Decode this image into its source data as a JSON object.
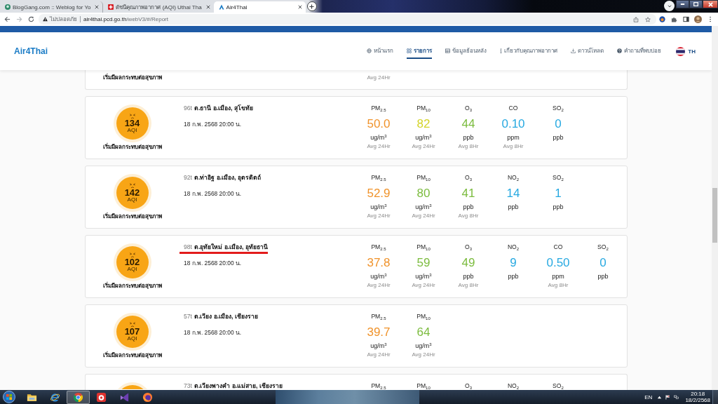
{
  "browser": {
    "tabs": [
      {
        "title": "BlogGang.com :: Weblog for Yo",
        "kind": "blog",
        "selected": false
      },
      {
        "title": "ดัชนีคุณภาพอากาศ (AQI) Uthai Tha",
        "kind": "cross",
        "selected": false
      },
      {
        "title": "Air4Thai",
        "kind": "air",
        "selected": true
      }
    ],
    "address": {
      "security": "ไม่ปลอดภัย",
      "host": "air4thai.pcd.go.th",
      "path": "/webV3/#/Report"
    }
  },
  "site": {
    "logo": "Air4Thai",
    "nav": [
      {
        "label": "หน้าแรก",
        "kind": "home",
        "selected": false
      },
      {
        "label": "รายการ",
        "kind": "list",
        "selected": true
      },
      {
        "label": "ข้อมูลย้อนหลัง",
        "kind": "history",
        "selected": false
      },
      {
        "label": "เกี่ยวกับคุณภาพอากาศ",
        "kind": "about",
        "selected": false
      },
      {
        "label": "ดาวน์โหลด",
        "kind": "download",
        "selected": false
      },
      {
        "label": "คำถามที่พบบ่อย",
        "kind": "faq",
        "selected": false
      }
    ],
    "language": "TH"
  },
  "stations": [
    {
      "kind": "cut_top",
      "status": "เริ่มมีผลกระทบต่อสุขภาพ",
      "metrics": [
        {
          "note": "Avg 24Hr"
        }
      ]
    },
    {
      "kind": "full",
      "code": "96t",
      "name": "ต.ธานี อ.เมือง, สุโขทัย",
      "time": "18 ก.พ. 2568 20:00 น.",
      "aqi": "134",
      "aqi_label": "AQI",
      "status": "เริ่มมีผลกระทบต่อสุขภาพ",
      "underlined": false,
      "metrics": [
        {
          "label": "PM$_{2.5}$",
          "value": "50.0",
          "color": "#f0932b",
          "unit": "ug/m$^{3}$",
          "note": "Avg 24Hr"
        },
        {
          "label": "PM$_{10}$",
          "value": "82",
          "color": "#d4d42a",
          "unit": "ug/m$^{3}$",
          "note": "Avg 24Hr"
        },
        {
          "label": "O$_{3}$",
          "value": "44",
          "color": "#7cbc3f",
          "unit": "ppb",
          "note": "Avg 8Hr"
        },
        {
          "label": "CO",
          "value": "0.10",
          "color": "#27a9e1",
          "unit": "ppm",
          "note": "Avg 8Hr"
        },
        {
          "label": "SO$_{2}$",
          "value": "0",
          "color": "#27a9e1",
          "unit": "ppb"
        }
      ]
    },
    {
      "kind": "full",
      "code": "92t",
      "name": "ต.ท่าอิฐ อ.เมือง, อุตรดิตถ์",
      "time": "18 ก.พ. 2568 20:00 น.",
      "aqi": "142",
      "aqi_label": "AQI",
      "status": "เริ่มมีผลกระทบต่อสุขภาพ",
      "underlined": false,
      "metrics": [
        {
          "label": "PM$_{2.5}$",
          "value": "52.9",
          "color": "#f0932b",
          "unit": "ug/m$^{3}$",
          "note": "Avg 24Hr"
        },
        {
          "label": "PM$_{10}$",
          "value": "80",
          "color": "#7cbc3f",
          "unit": "ug/m$^{3}$",
          "note": "Avg 24Hr"
        },
        {
          "label": "O$_{3}$",
          "value": "41",
          "color": "#7cbc3f",
          "unit": "ppb",
          "note": "Avg 8Hr"
        },
        {
          "label": "NO$_{2}$",
          "value": "14",
          "color": "#27a9e1",
          "unit": "ppb"
        },
        {
          "label": "SO$_{2}$",
          "value": "1",
          "color": "#27a9e1",
          "unit": "ppb"
        }
      ]
    },
    {
      "kind": "full",
      "code": "98t",
      "name": "ต.อุทัยใหม่ อ.เมือง, อุทัยธานี",
      "time": "18 ก.พ. 2568 20:00 น.",
      "aqi": "102",
      "aqi_label": "AQI",
      "status": "เริ่มมีผลกระทบต่อสุขภาพ",
      "underlined": true,
      "metrics": [
        {
          "label": "PM$_{2.5}$",
          "value": "37.8",
          "color": "#f0932b",
          "unit": "ug/m$^{3}$",
          "note": "Avg 24Hr"
        },
        {
          "label": "PM$_{10}$",
          "value": "59",
          "color": "#7cbc3f",
          "unit": "ug/m$^{3}$",
          "note": "Avg 24Hr"
        },
        {
          "label": "O$_{3}$",
          "value": "49",
          "color": "#7cbc3f",
          "unit": "ppb",
          "note": "Avg 8Hr"
        },
        {
          "label": "NO$_{2}$",
          "value": "9",
          "color": "#27a9e1",
          "unit": "ppb"
        },
        {
          "label": "CO",
          "value": "0.50",
          "color": "#27a9e1",
          "unit": "ppm",
          "note": "Avg 8Hr"
        },
        {
          "label": "SO$_{2}$",
          "value": "0",
          "color": "#27a9e1",
          "unit": "ppb"
        }
      ]
    },
    {
      "kind": "full",
      "code": "57t",
      "name": "ต.เวียง อ.เมือง, เชียงราย",
      "time": "18 ก.พ. 2568 20:00 น.",
      "aqi": "107",
      "aqi_label": "AQI",
      "status": "เริ่มมีผลกระทบต่อสุขภาพ",
      "underlined": false,
      "metrics": [
        {
          "label": "PM$_{2.5}$",
          "value": "39.7",
          "color": "#f0932b",
          "unit": "ug/m$^{3}$",
          "note": "Avg 24Hr"
        },
        {
          "label": "PM$_{10}$",
          "value": "64",
          "color": "#7cbc3f",
          "unit": "ug/m$^{3}$",
          "note": "Avg 24Hr"
        }
      ]
    },
    {
      "kind": "cut_bottom",
      "code": "73t",
      "name": "ต.เวียงพางคำ อ.แม่สาย, เชียงราย",
      "metrics": [
        {
          "label": "PM$_{2.5}$"
        },
        {
          "label": "PM$_{10}$"
        },
        {
          "label": "O$_{3}$"
        },
        {
          "label": "NO$_{2}$"
        },
        {
          "label": "SO$_{2}$"
        }
      ]
    }
  ],
  "taskbar": {
    "apps": [
      {
        "kind": "folder",
        "selected": false
      },
      {
        "kind": "e",
        "selected": false
      },
      {
        "kind": "ring",
        "selected": true
      },
      {
        "kind": "tile",
        "selected": false
      },
      {
        "kind": "ribbon",
        "selected": false
      },
      {
        "kind": "fox",
        "selected": false
      }
    ],
    "language": "EN",
    "time": "20:18",
    "date": "18/2/2568"
  }
}
